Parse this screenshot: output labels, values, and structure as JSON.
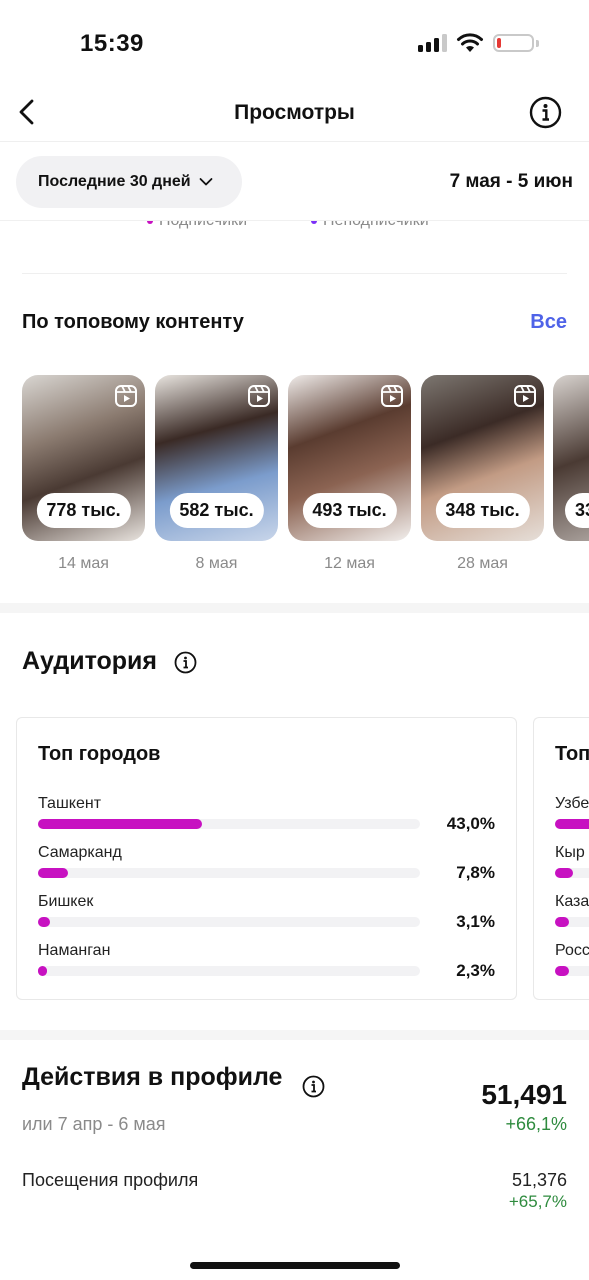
{
  "status_bar": {
    "time": "15:39",
    "battery_color": "#e53935"
  },
  "header": {
    "title": "Просмотры",
    "back_icon": "chevron-left-icon",
    "info_icon": "info-icon"
  },
  "filter": {
    "period_label": "Последние 30 дней",
    "date_range": "7 мая - 5 июн"
  },
  "legend": {
    "followers": "Подписчики",
    "non_followers": "Неподписчики",
    "followers_color": "#c711c1",
    "non_followers_color": "#7b2ff7"
  },
  "top_content": {
    "title": "По топовому контенту",
    "see_all": "Все",
    "items": [
      {
        "views": "778 тыс.",
        "date": "14 мая"
      },
      {
        "views": "582 тыс.",
        "date": "8 мая"
      },
      {
        "views": "493 тыс.",
        "date": "12 мая"
      },
      {
        "views": "348 тыс.",
        "date": "28 мая"
      },
      {
        "views": "33",
        "date": ""
      }
    ]
  },
  "audience": {
    "title": "Аудитория",
    "top_cities": {
      "title": "Топ городов",
      "rows": [
        {
          "label": "Ташкент",
          "value": "43,0%",
          "fraction": 0.43
        },
        {
          "label": "Самарканд",
          "value": "7,8%",
          "fraction": 0.078
        },
        {
          "label": "Бишкек",
          "value": "3,1%",
          "fraction": 0.031
        },
        {
          "label": "Наманган",
          "value": "2,3%",
          "fraction": 0.023
        }
      ]
    },
    "top_countries_peek": {
      "title": "Топ",
      "rows": [
        {
          "label": "Узбе",
          "fraction": 0.6
        },
        {
          "label": "Кыр",
          "fraction": 0.08
        },
        {
          "label": "Каза",
          "fraction": 0.06
        },
        {
          "label": "Росс",
          "fraction": 0.06
        }
      ]
    },
    "bar_color": "#c711c1"
  },
  "profile_actions": {
    "title": "Действия в профиле",
    "period": "или 7 апр - 6 мая",
    "total": "51,491",
    "total_change": "+66,1%",
    "visits_label": "Посещения профиля",
    "visits_value": "51,376",
    "visits_change": "+65,7%",
    "positive_color": "#2e8b3e"
  }
}
